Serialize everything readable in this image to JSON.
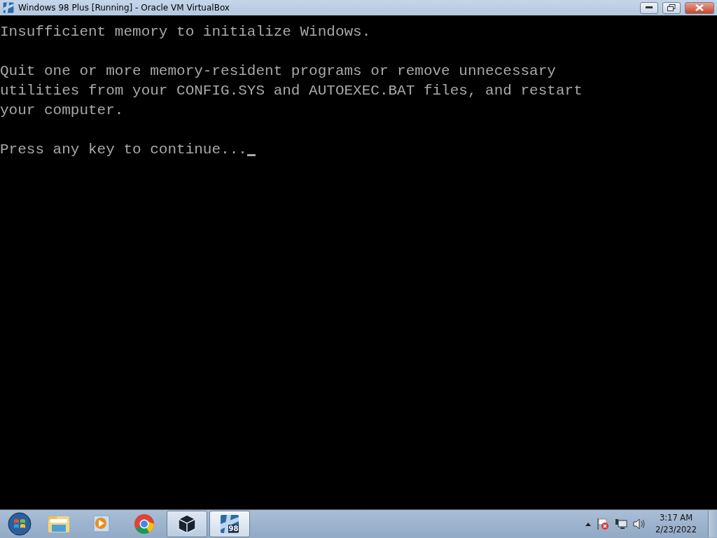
{
  "window": {
    "title": "Windows 98 Plus [Running] - Oracle VM VirtualBox"
  },
  "console": {
    "paragraphs": [
      {
        "lines": [
          "Insufficient memory to initialize Windows."
        ],
        "cursor": false
      },
      {
        "lines": [
          "Quit one or more memory-resident programs or remove unnecessary",
          "utilities from your CONFIG.SYS and AUTOEXEC.BAT files, and restart",
          "your computer."
        ],
        "cursor": false
      },
      {
        "lines": [
          "Press any key to continue..."
        ],
        "cursor": true
      }
    ]
  },
  "taskbar": {
    "items": [
      {
        "kind": "explorer",
        "running": false,
        "active": false
      },
      {
        "kind": "media",
        "running": false,
        "active": false
      },
      {
        "kind": "chrome",
        "running": false,
        "active": false
      },
      {
        "kind": "virtualbox",
        "running": true,
        "active": false
      },
      {
        "kind": "vm",
        "running": true,
        "active": true,
        "badge": "98"
      }
    ],
    "clock": {
      "time": "3:17 AM",
      "date": "2/23/2022"
    }
  }
}
